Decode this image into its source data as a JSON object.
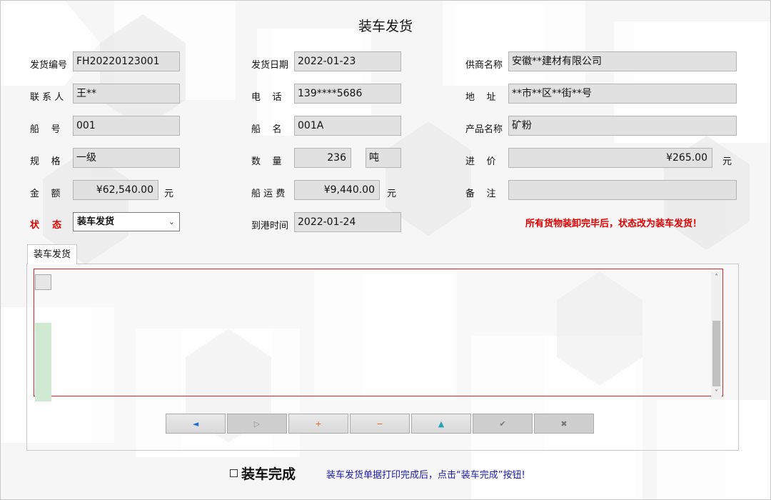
{
  "title": "装车发货",
  "fields": {
    "shipment_no": {
      "label": "发货编号",
      "value": "FH20220123001"
    },
    "ship_date": {
      "label": "发货日期",
      "value": "2022-01-23"
    },
    "supplier": {
      "label": "供商名称",
      "value": "安徽**建材有限公司"
    },
    "contact": {
      "label": "联 系 人",
      "value": "王**"
    },
    "phone": {
      "label": "电    话",
      "value": "139****5686"
    },
    "address": {
      "label": "地    址",
      "value": "**市**区**街**号"
    },
    "ship_number": {
      "label": "船    号",
      "value": "001"
    },
    "ship_name": {
      "label": "船    名",
      "value": "001A"
    },
    "product": {
      "label": "产品名称",
      "value": "矿粉"
    },
    "spec": {
      "label": "规    格",
      "value": "一级"
    },
    "quantity": {
      "label": "数    量",
      "value": "236",
      "unit": "吨"
    },
    "price": {
      "label": "进    价",
      "value": "¥265.00",
      "unit": "元"
    },
    "amount": {
      "label": "金    额",
      "value": "¥62,540.00",
      "unit": "元"
    },
    "freight": {
      "label": "船 运 费",
      "value": "¥9,440.00",
      "unit": "元"
    },
    "remark": {
      "label": "备    注",
      "value": ""
    },
    "status": {
      "label": "状    态",
      "value": "装车发货"
    },
    "arrival": {
      "label": "到港时间",
      "value": "2022-01-24"
    }
  },
  "status_note": "所有货物装卸完毕后，状态改为装车发货！",
  "tab_label": "装车发货",
  "nav_buttons": [
    {
      "icon": "prev-arrow-icon",
      "glyph": "◄",
      "color": "#1c6fd1"
    },
    {
      "icon": "next-arrow-icon",
      "glyph": "▷",
      "color": "#8c8c8c"
    },
    {
      "icon": "add-icon",
      "glyph": "+",
      "color": "#e8601c"
    },
    {
      "icon": "delete-icon",
      "glyph": "−",
      "color": "#e8601c"
    },
    {
      "icon": "edit-icon",
      "glyph": "▲",
      "color": "#27a0b8"
    },
    {
      "icon": "confirm-icon",
      "glyph": "✔",
      "color": "#777777"
    },
    {
      "icon": "cancel-icon",
      "glyph": "✖",
      "color": "#777777"
    }
  ],
  "complete_label": "装车完成",
  "complete_note": "装车发货单据打印完成后，点击“装车完成”按钮!"
}
